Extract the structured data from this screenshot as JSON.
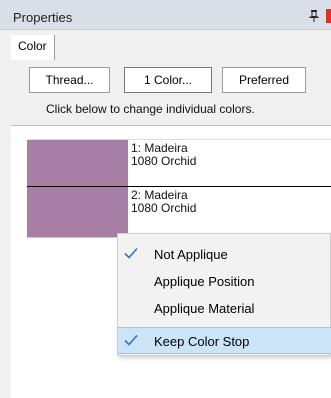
{
  "panel": {
    "title": "Properties"
  },
  "tabs": [
    {
      "label": "Color"
    }
  ],
  "buttons": {
    "thread": "Thread...",
    "one_color": "1 Color...",
    "preferred": "Preferred"
  },
  "hint": "Click below to change individual colors.",
  "colors": [
    {
      "line1": "1: Madeira",
      "line2": "1080 Orchid",
      "swatch": "#a77ea6"
    },
    {
      "line1": "2: Madeira",
      "line2": "1080 Orchid",
      "swatch": "#a77ea6"
    }
  ],
  "context_menu": [
    {
      "label": "Not Applique",
      "checked": true
    },
    {
      "label": "Applique Position",
      "checked": false
    },
    {
      "label": "Applique Material",
      "checked": false
    },
    {
      "label": "Keep Color Stop",
      "checked": true
    }
  ],
  "colors_theme": {
    "check": "#2e73c9",
    "highlight": "#cce4f7",
    "close_accent": "#d9342b"
  }
}
